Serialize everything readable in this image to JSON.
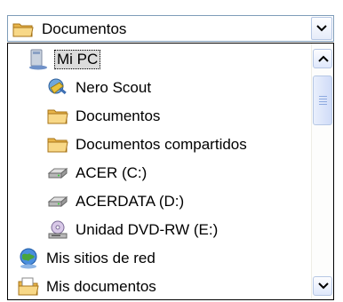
{
  "combo": {
    "value": "Documentos",
    "icon": "folder-icon"
  },
  "list": {
    "items": [
      {
        "label": "Mi PC",
        "icon": "computer-icon",
        "level": 0,
        "selected": true
      },
      {
        "label": "Nero Scout",
        "icon": "nero-scout-icon",
        "level": 1
      },
      {
        "label": "Documentos",
        "icon": "folder-icon",
        "level": 1
      },
      {
        "label": "Documentos compartidos",
        "icon": "folder-icon",
        "level": 1
      },
      {
        "label": "ACER (C:)",
        "icon": "hard-drive-icon",
        "level": 1
      },
      {
        "label": "ACERDATA (D:)",
        "icon": "hard-drive-icon",
        "level": 1
      },
      {
        "label": "Unidad DVD-RW (E:)",
        "icon": "dvd-drive-icon",
        "level": 1
      },
      {
        "label": "Mis sitios de red",
        "icon": "network-places-icon",
        "level": 0
      },
      {
        "label": "Mis documentos",
        "icon": "my-documents-icon",
        "level": 0
      }
    ]
  },
  "colors": {
    "border": "#7f9db9",
    "scroll_accent": "#b6c7e4",
    "selection": "#dcdcdc"
  }
}
